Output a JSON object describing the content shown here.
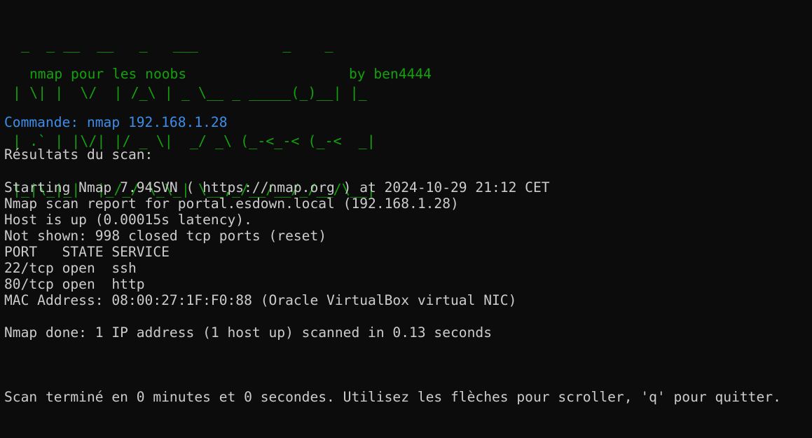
{
  "banner": {
    "ascii_art": [
      " _  _ __  __   _   ___          _    _",
      "| \\| |  \\/  | /_\\ | _ \\__ _ _____(_)__| |_",
      "| .` | |\\/| |/ _ \\|  _/ _\\ (_-<_-< (_-<  _|",
      "|_|\\_|_|  |_/_/ \\_\\_| \\__,_/__/__/_/__/\\__|"
    ],
    "tagline": "nmap pour les noobs",
    "author": "by ben4444"
  },
  "command": {
    "label": "Commande: nmap 192.168.1.28"
  },
  "results_label": "Résultats du scan:",
  "output_lines": [
    "Starting Nmap 7.94SVN ( https://nmap.org ) at 2024-10-29 21:12 CET",
    "Nmap scan report for portal.esdown.local (192.168.1.28)",
    "Host is up (0.00015s latency).",
    "Not shown: 998 closed tcp ports (reset)",
    "PORT   STATE SERVICE",
    "22/tcp open  ssh",
    "80/tcp open  http",
    "MAC Address: 08:00:27:1F:F0:88 (Oracle VirtualBox virtual NIC)",
    "",
    "Nmap done: 1 IP address (1 host up) scanned in 0.13 seconds"
  ],
  "footer": "Scan terminé en 0 minutes et 0 secondes. Utilisez les flèches pour scroller, 'q' pour quitter.",
  "colors": {
    "background": "#0c0c0c",
    "text": "#cccccc",
    "banner": "#13a10e",
    "command": "#3b8eea"
  }
}
